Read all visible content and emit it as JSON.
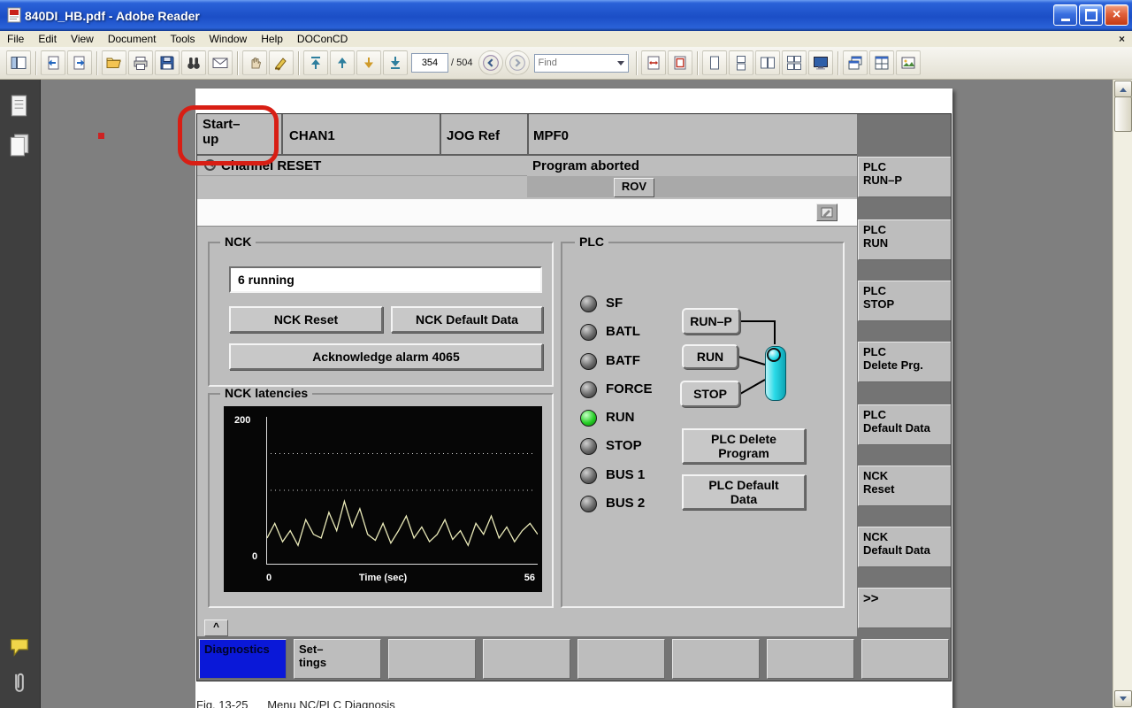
{
  "window": {
    "title": "840DI_HB.pdf - Adobe Reader"
  },
  "menubar": {
    "items": [
      "File",
      "Edit",
      "View",
      "Document",
      "Tools",
      "Window",
      "Help",
      "DOConCD"
    ],
    "close_glyph": "×"
  },
  "toolbar": {
    "page_number": "354",
    "page_total": "/ 504",
    "find_placeholder": "Find",
    "icons": [
      "navigation-panels",
      "previous-document",
      "next-document",
      "open",
      "print",
      "save",
      "search",
      "email",
      "hand-tool",
      "sign-tool",
      "first-page",
      "previous-page",
      "next-page",
      "last-page",
      "previous-view",
      "next-view",
      "fit-width",
      "fit-page",
      "single-page",
      "continuous",
      "facing",
      "continuous-facing",
      "full-screen",
      "cascade-windows",
      "tile-windows",
      "picture-tasks"
    ]
  },
  "sidebar": {
    "icons": [
      "pages",
      "bookmarks",
      "comments",
      "attachments"
    ]
  },
  "hmi": {
    "header": {
      "area": "Start–\nup",
      "channel": "CHAN1",
      "mode": "JOG Ref",
      "program": "MPF0",
      "channel_status": "Channel RESET",
      "program_status": "Program aborted",
      "rov": "ROV"
    },
    "nck": {
      "title": "NCK",
      "status": "6 running",
      "btn_reset": "NCK Reset",
      "btn_default": "NCK Default Data",
      "btn_acknowledge": "Acknowledge alarm 4065"
    },
    "latencies": {
      "title": "NCK latencies"
    },
    "plc": {
      "title": "PLC",
      "leds": [
        {
          "label": "SF",
          "on": false
        },
        {
          "label": "BATL",
          "on": false
        },
        {
          "label": "BATF",
          "on": false
        },
        {
          "label": "FORCE",
          "on": false
        },
        {
          "label": "RUN",
          "on": true
        },
        {
          "label": "STOP",
          "on": false
        },
        {
          "label": "BUS 1",
          "on": false
        },
        {
          "label": "BUS 2",
          "on": false
        }
      ],
      "switch_positions": [
        "RUN–P",
        "RUN",
        "STOP"
      ],
      "btn_delete": "PLC Delete\nProgram",
      "btn_default": "PLC Default\nData"
    },
    "softkeys_right": [
      "PLC\nRUN–P",
      "PLC\nRUN",
      "PLC\nSTOP",
      "PLC\nDelete Prg.",
      "PLC\nDefault Data",
      "NCK\nReset",
      "NCK\nDefault Data",
      ">>"
    ],
    "softkeys_bottom": [
      "Diagnostics",
      "Set–\ntings",
      "",
      "",
      "",
      "",
      "",
      ""
    ],
    "recall": "^"
  },
  "caption": "Fig. 13-25      Menu NC/PLC Diagnosis",
  "chart_data": {
    "type": "line",
    "title": "NCK latencies",
    "xlabel": "Time (sec)",
    "x_range": [
      0,
      56
    ],
    "y_range": [
      0,
      200
    ],
    "y_top_label": "200",
    "y_bottom_label": "0",
    "x_left_label": "0",
    "x_right_label": "56",
    "gridlines_y": [
      150,
      100
    ],
    "grid": "dotted-horizontal",
    "legend": "none",
    "series": [
      {
        "name": "latency",
        "values": [
          35,
          55,
          30,
          45,
          25,
          60,
          40,
          35,
          70,
          45,
          85,
          50,
          75,
          40,
          32,
          55,
          28,
          45,
          65,
          35,
          50,
          30,
          40,
          60,
          33,
          45,
          25,
          55,
          40,
          65,
          35,
          50,
          30,
          45,
          55,
          40
        ]
      }
    ]
  },
  "colors": {
    "titlebar_blue": "#2a62d8",
    "close_red": "#d9512c",
    "hmi_background": "#bdbdbd",
    "selected_softkey_blue": "#0a18d8",
    "led_on_green": "#27cf27",
    "switch_cyan": "#2adbe8",
    "annotation_red": "#d81e14",
    "chart_line": "#e9e9b8"
  }
}
